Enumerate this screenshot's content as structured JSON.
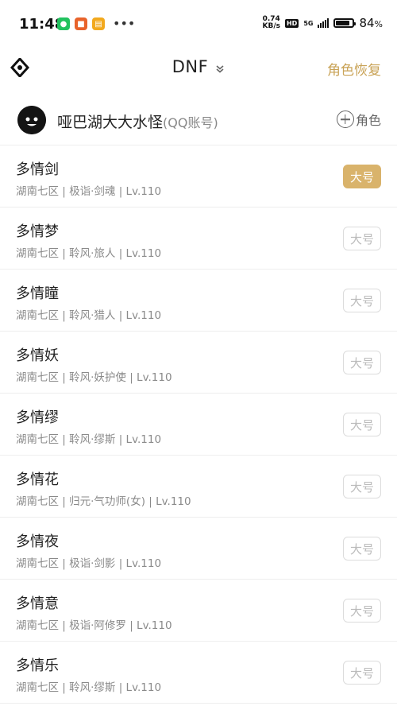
{
  "status_bar": {
    "time": "11:48",
    "net_speed_value": "0.74",
    "net_speed_unit": "KB/s",
    "hd": "HD",
    "network": "5G",
    "battery_percent": "84",
    "battery_level": 0.84,
    "battery_pct_symbol": "%"
  },
  "nav": {
    "title": "DNF",
    "restore_label": "角色恢复"
  },
  "account": {
    "name": "哑巴湖大大水怪",
    "type": "(QQ账号)",
    "add_role_label": "角色"
  },
  "characters": [
    {
      "name": "多情剑",
      "info": "湖南七区 | 极诣·剑魂 | Lv.110",
      "badge": "大号",
      "active": true
    },
    {
      "name": "多情梦",
      "info": "湖南七区 | 聆风·旅人 | Lv.110",
      "badge": "大号",
      "active": false
    },
    {
      "name": "多情瞳",
      "info": "湖南七区 | 聆风·猎人 | Lv.110",
      "badge": "大号",
      "active": false
    },
    {
      "name": "多情妖",
      "info": "湖南七区 | 聆风·妖护使 | Lv.110",
      "badge": "大号",
      "active": false
    },
    {
      "name": "多情缪",
      "info": "湖南七区 | 聆风·缪斯 | Lv.110",
      "badge": "大号",
      "active": false
    },
    {
      "name": "多情花",
      "info": "湖南七区 | 归元·气功师(女) | Lv.110",
      "badge": "大号",
      "active": false
    },
    {
      "name": "多情夜",
      "info": "湖南七区 | 极诣·剑影 | Lv.110",
      "badge": "大号",
      "active": false
    },
    {
      "name": "多情意",
      "info": "湖南七区 | 极诣·阿修罗 | Lv.110",
      "badge": "大号",
      "active": false
    },
    {
      "name": "多情乐",
      "info": "湖南七区 | 聆风·缪斯 | Lv.110",
      "badge": "大号",
      "active": false
    }
  ],
  "colors": {
    "accent": "#c9a357",
    "badge_active": "#d9b36b"
  }
}
